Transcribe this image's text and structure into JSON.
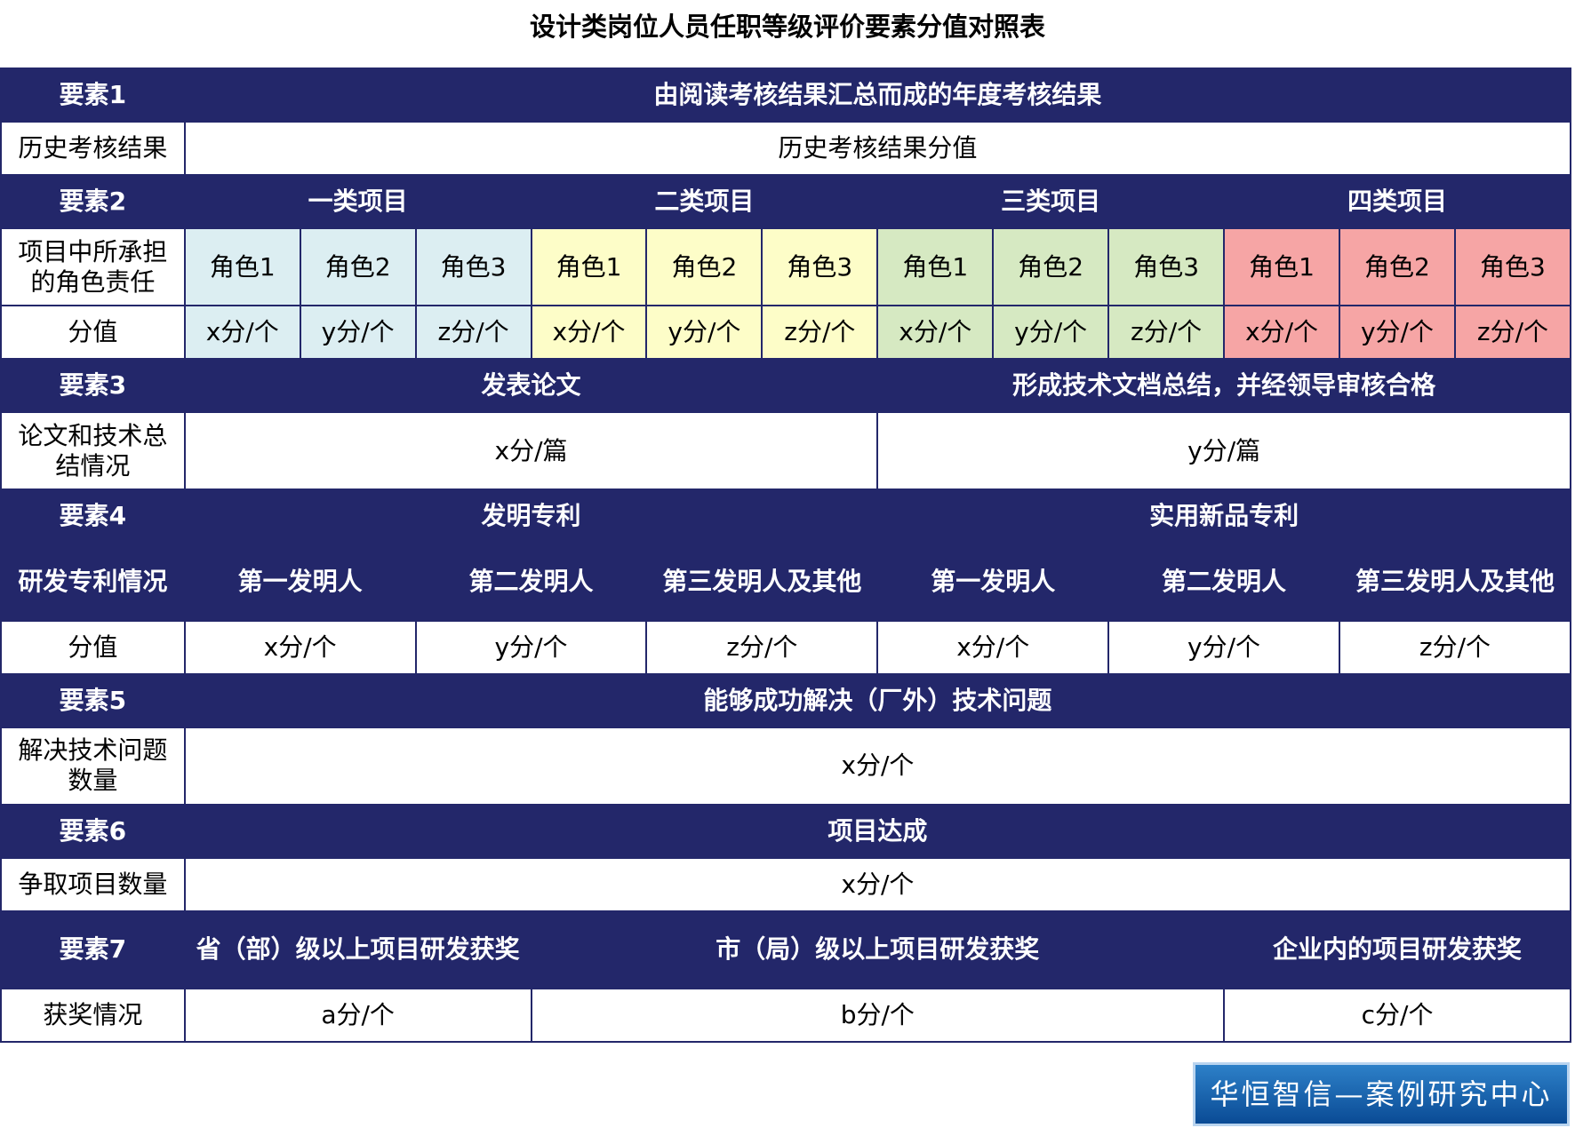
{
  "title": "设计类岗位人员任职等级评价要素分值对照表",
  "colors": {
    "header_bg": "#23276a",
    "class1": "#dceef2",
    "class2": "#fdfdc8",
    "class3": "#d6e9c2",
    "class4": "#f6a5a5"
  },
  "e1": {
    "head": "要素1",
    "desc": "由阅读考核结果汇总而成的年度考核结果",
    "label": "历史考核结果",
    "value": "历史考核结果分值"
  },
  "e2": {
    "head": "要素2",
    "classes": [
      "一类项目",
      "二类项目",
      "三类项目",
      "四类项目"
    ],
    "role_label": "项目中所承担的角色责任",
    "roles": [
      "角色1",
      "角色2",
      "角色3"
    ],
    "score_label": "分值",
    "scores": [
      "x分/个",
      "y分/个",
      "z分/个"
    ]
  },
  "e3": {
    "head": "要素3",
    "col1": "发表论文",
    "col2": "形成技术文档总结，并经领导审核合格",
    "label": "论文和技术总结情况",
    "val1": "x分/篇",
    "val2": "y分/篇"
  },
  "e4": {
    "head": "要素4",
    "col1": "发明专利",
    "col2": "实用新品专利",
    "sub_label": "研发专利情况",
    "inventors": [
      "第一发明人",
      "第二发明人",
      "第三发明人及其他"
    ],
    "score_label": "分值",
    "scores": [
      "x分/个",
      "y分/个",
      "z分/个"
    ]
  },
  "e5": {
    "head": "要素5",
    "desc": "能够成功解决（厂外）技术问题",
    "label": "解决技术问题数量",
    "value": "x分/个"
  },
  "e6": {
    "head": "要素6",
    "desc": "项目达成",
    "label": "争取项目数量",
    "value": "x分/个"
  },
  "e7": {
    "head": "要素7",
    "col1": "省（部）级以上项目研发获奖",
    "col2": "市（局）级以上项目研发获奖",
    "col3": "企业内的项目研发获奖",
    "label": "获奖情况",
    "val1": "a分/个",
    "val2": "b分/个",
    "val3": "c分/个"
  },
  "brand": "华恒智信—案例研究中心"
}
